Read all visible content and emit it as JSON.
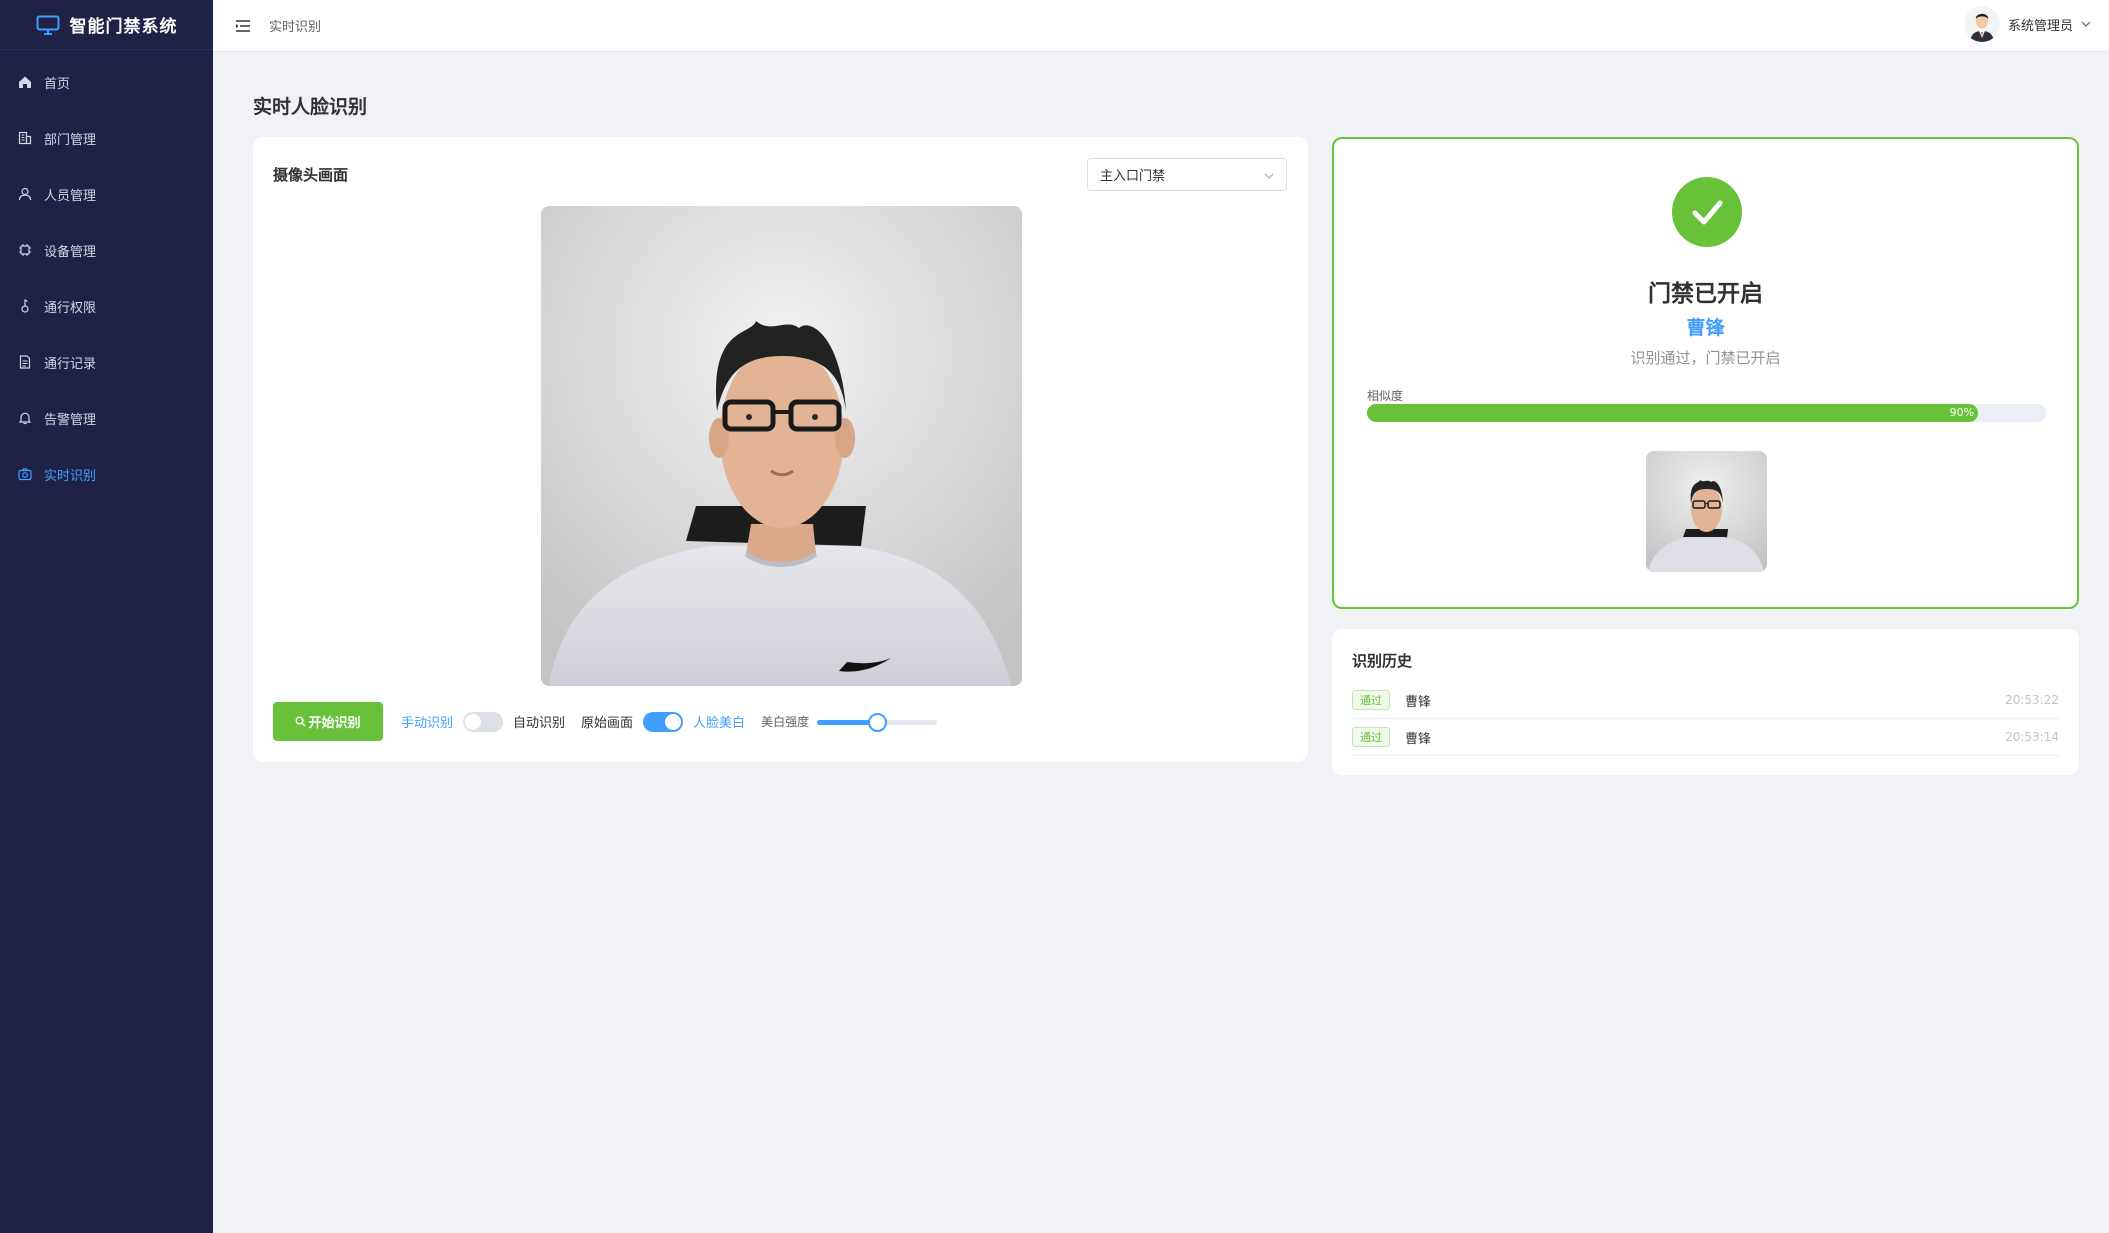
{
  "app": {
    "title": "智能门禁系统"
  },
  "sidebar": {
    "items": [
      {
        "label": "首页",
        "icon": "home-icon",
        "active": false
      },
      {
        "label": "部门管理",
        "icon": "building-icon",
        "active": false
      },
      {
        "label": "人员管理",
        "icon": "user-icon",
        "active": false
      },
      {
        "label": "设备管理",
        "icon": "chip-icon",
        "active": false
      },
      {
        "label": "通行权限",
        "icon": "permission-icon",
        "active": false
      },
      {
        "label": "通行记录",
        "icon": "document-icon",
        "active": false
      },
      {
        "label": "告警管理",
        "icon": "bell-icon",
        "active": false
      },
      {
        "label": "实时识别",
        "icon": "camera-icon",
        "active": true
      }
    ]
  },
  "header": {
    "breadcrumb": "实时识别",
    "user_name": "系统管理员"
  },
  "main": {
    "title": "实时人脸识别",
    "camera": {
      "title": "摄像头画面",
      "device_selected": "主入口门禁",
      "start_button": "开始识别",
      "manual_label": "手动识别",
      "auto_label": "自动识别",
      "manual_auto_switch_on": false,
      "original_label": "原始画面",
      "beauty_label": "人脸美白",
      "beauty_switch_on": true,
      "strength_label": "美白强度",
      "strength_value": 0.5
    },
    "result": {
      "title": "门禁已开启",
      "name": "曹锋",
      "message": "识别通过，门禁已开启",
      "similarity_label": "相似度",
      "similarity_percent": 90,
      "similarity_text": "90%"
    },
    "history": {
      "title": "识别历史",
      "records": [
        {
          "status": "通过",
          "name": "曹锋",
          "time": "20:53:22"
        },
        {
          "status": "通过",
          "name": "曹锋",
          "time": "20:53:14"
        }
      ]
    }
  },
  "colors": {
    "sidebar_bg": "#1f2246",
    "accent": "#409eff",
    "success": "#67c23a"
  }
}
